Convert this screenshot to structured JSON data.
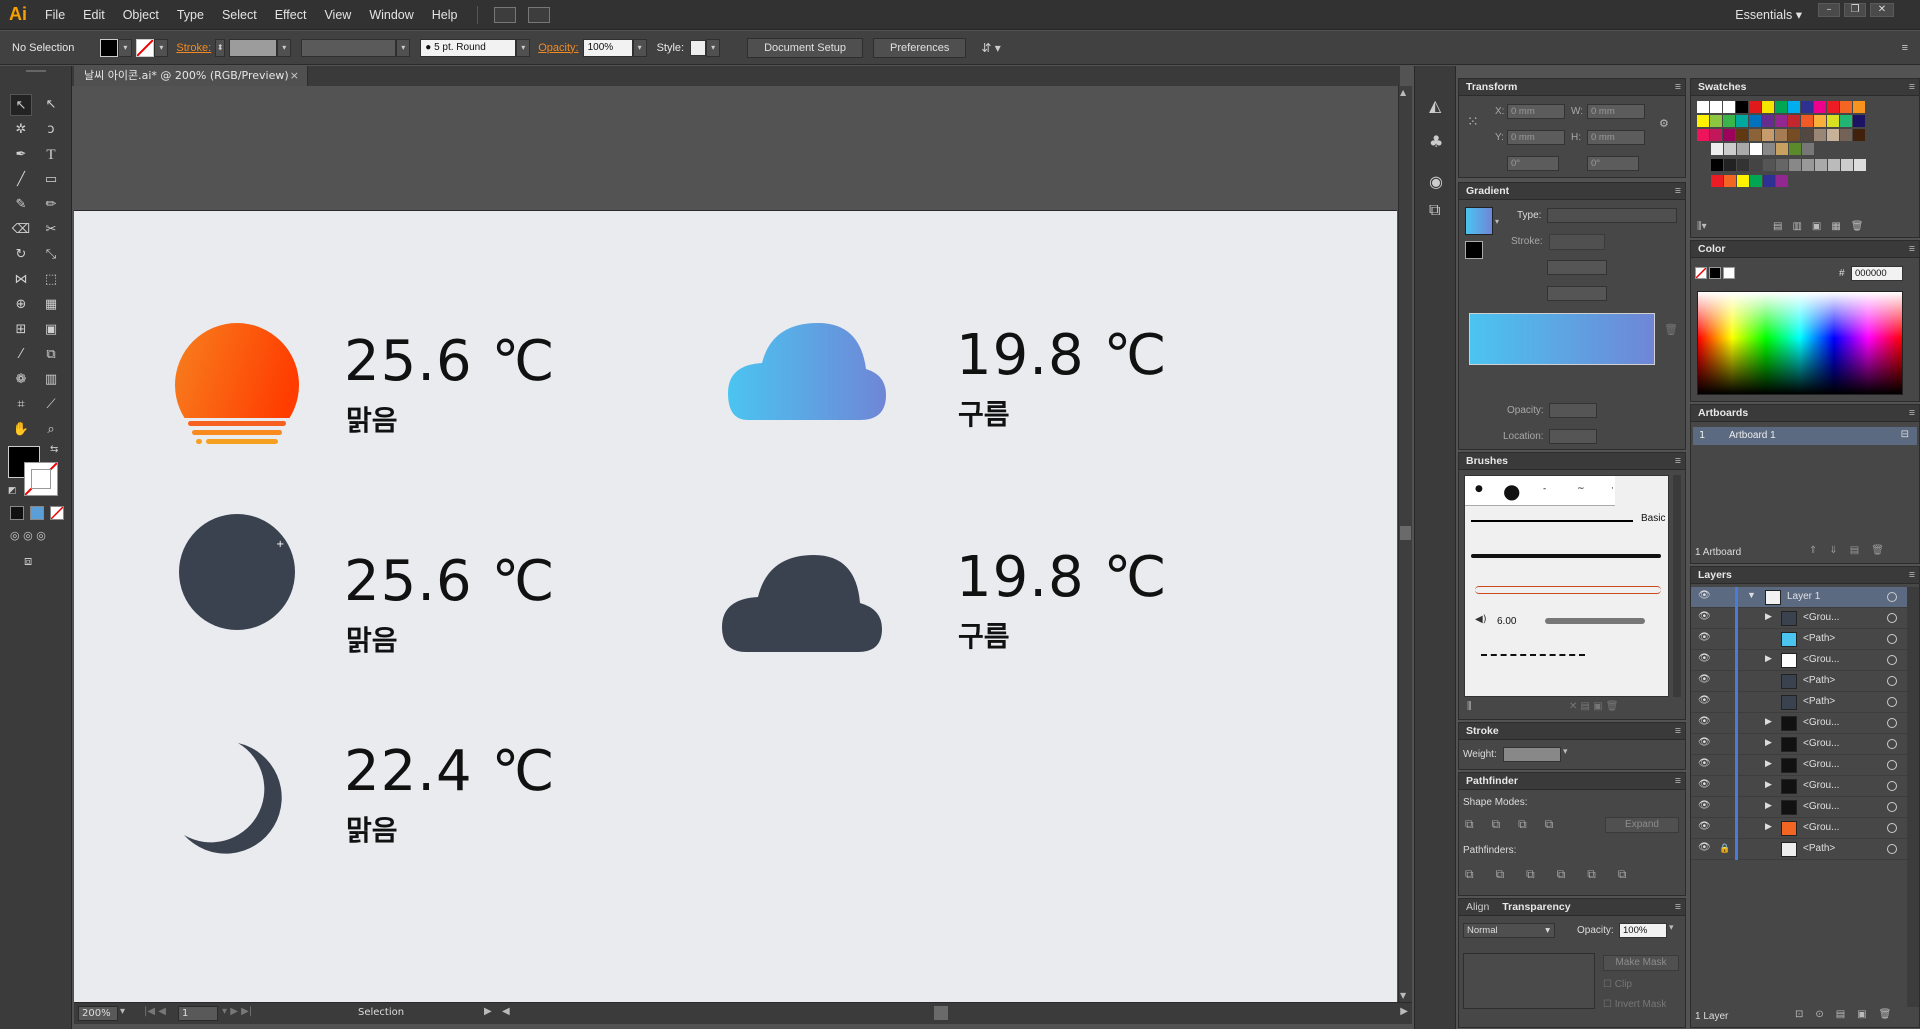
{
  "app": {
    "logo": "Ai",
    "workspace": "Essentials"
  },
  "menu": [
    "File",
    "Edit",
    "Object",
    "Type",
    "Select",
    "Effect",
    "View",
    "Window",
    "Help"
  ],
  "control_bar": {
    "selection": "No Selection",
    "stroke_label": "Stroke:",
    "brush": "5 pt. Round",
    "opacity_label": "Opacity:",
    "opacity_value": "100%",
    "style_label": "Style:",
    "document_setup": "Document Setup",
    "preferences": "Preferences"
  },
  "document": {
    "tab_title": "날씨 아이콘.ai* @ 200% (RGB/Preview)"
  },
  "weather": [
    {
      "temp": "25.6 ℃",
      "cond": "맑음",
      "icon": "sunset-icon"
    },
    {
      "temp": "19.8 ℃",
      "cond": "구름",
      "icon": "cloud-gradient-icon"
    },
    {
      "temp": "25.6 ℃",
      "cond": "맑음",
      "icon": "moon-full-icon"
    },
    {
      "temp": "19.8 ℃",
      "cond": "구름",
      "icon": "cloud-dark-icon"
    },
    {
      "temp": "22.4 ℃",
      "cond": "맑음",
      "icon": "crescent-moon-icon"
    }
  ],
  "colors": {
    "sun_from": "#f7801f",
    "sun_to": "#ff3d00",
    "cloud_from": "#4bc4f0",
    "cloud_to": "#6f86d6",
    "dark": "#3a4250",
    "artboard": "#e9ebef"
  },
  "status": {
    "zoom": "200%",
    "page": "1",
    "tool": "Selection"
  },
  "transform": {
    "title": "Transform",
    "x_label": "X:",
    "x": "0 mm",
    "y_label": "Y:",
    "y": "0 mm",
    "w_label": "W:",
    "w": "0 mm",
    "h_label": "H:",
    "h": "0 mm",
    "rot": "0°",
    "shear": "0°"
  },
  "gradient": {
    "title": "Gradient",
    "type_label": "Type:",
    "stroke_label": "Stroke:",
    "opacity_label": "Opacity:",
    "location_label": "Location:"
  },
  "brushes": {
    "title": "Brushes",
    "basic": "Basic",
    "size": "6.00"
  },
  "stroke": {
    "title": "Stroke",
    "weight_label": "Weight:"
  },
  "pathfinder": {
    "title": "Pathfinder",
    "shape_modes": "Shape Modes:",
    "expand": "Expand",
    "pathfinders": "Pathfinders:"
  },
  "transparency": {
    "align_tab": "Align",
    "title": "Transparency",
    "mode": "Normal",
    "opacity_label": "Opacity:",
    "opacity": "100%",
    "make_mask": "Make Mask",
    "clip": "Clip",
    "invert": "Invert Mask"
  },
  "swatches": {
    "title": "Swatches"
  },
  "color": {
    "title": "Color",
    "hash": "#",
    "hex": "000000"
  },
  "artboards": {
    "title": "Artboards",
    "num": "1",
    "name": "Artboard 1",
    "count": "1 Artboard"
  },
  "layers": {
    "title": "Layers",
    "layer_name": "Layer 1",
    "items": [
      "<Grou...",
      "<Path>",
      "<Grou...",
      "<Path>",
      "<Path>",
      "<Grou...",
      "<Grou...",
      "<Grou...",
      "<Grou...",
      "<Grou...",
      "<Grou...",
      "<Path>"
    ],
    "count": "1 Layer"
  }
}
